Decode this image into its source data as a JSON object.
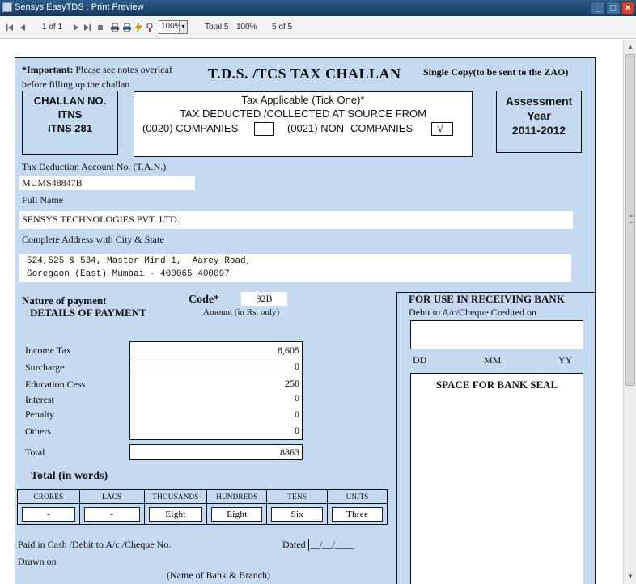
{
  "window": {
    "title": "Sensys EasyTDS : Print Preview"
  },
  "toolbar": {
    "page_label": "1 of 1",
    "zoom_value": "100%",
    "total_label": "Total:5",
    "percent_label": "100%",
    "of_label": "5 of 5"
  },
  "challan": {
    "important_label": "*Important:",
    "important_note": "Please see notes overleaf",
    "important_note2": "before filling up the challan",
    "main_title": "T.D.S. /TCS TAX CHALLAN",
    "copy_note": "Single Copy(to be sent to the ZAO)",
    "challan_no": {
      "line1": "CHALLAN NO.",
      "line2": "ITNS",
      "line3": "ITNS 281"
    },
    "tax_applicable": {
      "line1": "Tax Applicable (Tick One)*",
      "line2": "TAX DEDUCTED /COLLECTED AT SOURCE FROM",
      "companies": "(0020) COMPANIES",
      "non_companies": "(0021) NON- COMPANIES",
      "tick": "√"
    },
    "assessment": {
      "line1": "Assessment",
      "line2": "Year",
      "line3": "2011-2012"
    },
    "tan_label": "Tax Deduction Account No. (T.A.N.)",
    "tan_value": "MUMS48847B",
    "fullname_label": "Full Name",
    "fullname_value": "SENSYS TECHNOLOGIES PVT. LTD.",
    "address_label": "Complete Address with City & State",
    "address_line1": "524,525 & 534, Master Mind 1,  Aarey Road,",
    "address_line2": "Goregaon (East) Mumbai - 400065 400097",
    "nature_label": "Nature of payment",
    "details_label": "DETAILS OF PAYMENT",
    "code_label": "Code*",
    "code_value": "92B",
    "amount_label": "Amount  (in Rs. only)",
    "payments": [
      {
        "label": "Income Tax",
        "value": "8,605"
      },
      {
        "label": "Surcharge",
        "value": "0"
      },
      {
        "label": "Education Cess",
        "value": "258"
      },
      {
        "label": "Interest",
        "value": "0"
      },
      {
        "label": "Penalty",
        "value": "0"
      },
      {
        "label": "Others",
        "value": "0"
      }
    ],
    "total_label": "Total",
    "total_value": "8863",
    "total_words_label": "Total (in words)",
    "words_table": {
      "headers": [
        "CRORES",
        "LACS",
        "THOUSANDS",
        "HUNDREDS",
        "TENS",
        "UNITS"
      ],
      "values": [
        "-",
        "-",
        "Eight",
        "Eight",
        "Six",
        "Three"
      ]
    },
    "paid_in_label": "Paid in  Cash /Debit to A/c /Cheque No.",
    "dated_label": "Dated",
    "dated_value": "__/__/____",
    "drawn_on_label": "Drawn on",
    "bank_branch_label": "(Name of Bank & Branch)",
    "bank": {
      "title": "FOR USE IN RECEIVING BANK",
      "debit_label": "Debit to A/c/Cheque Credited on",
      "dd": "DD",
      "mm": "MM",
      "yy": "YY",
      "seal_label": "SPACE FOR BANK SEAL"
    }
  }
}
